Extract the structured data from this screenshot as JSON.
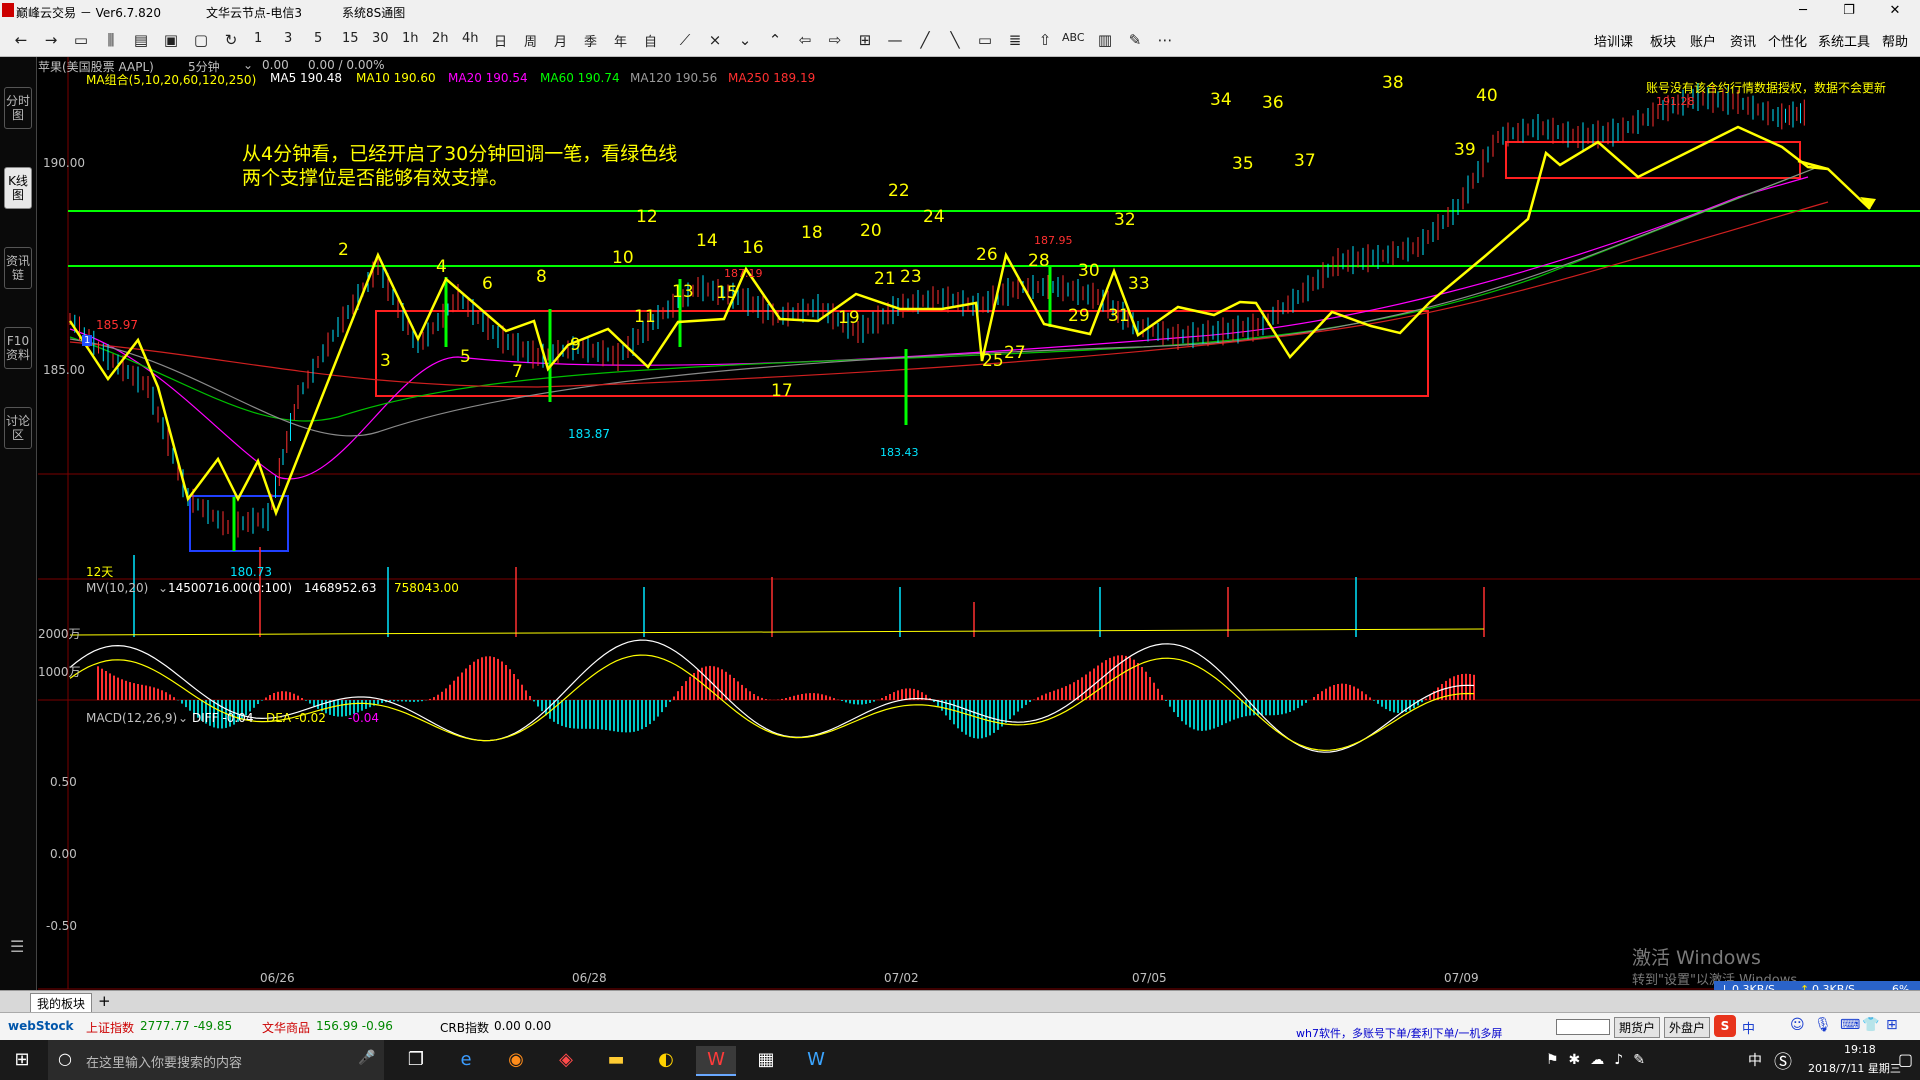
{
  "window": {
    "app_title": "巅峰云交易 － Ver6.7.820",
    "server": "文华云节点-电信3",
    "system_menu": "系统8S通图",
    "minimize": "─",
    "restore": "❐",
    "close": "✕"
  },
  "toolbar": {
    "periods": [
      "1",
      "3",
      "5",
      "15",
      "30",
      "1h",
      "2h",
      "4h",
      "日",
      "周",
      "月",
      "季",
      "年",
      "自"
    ],
    "label_abc": "ABC",
    "menus": [
      "培训课",
      "板块",
      "账户",
      "资讯",
      "个性化",
      "系统工具",
      "帮助"
    ]
  },
  "side_tabs": [
    "分时图",
    "K线图",
    "资讯链",
    "F10资料",
    "讨论区"
  ],
  "instrument": {
    "name": "苹果(美国股票 AAPL)",
    "period": "5分钟",
    "price": "0.00",
    "change": "0.00 / 0.00%"
  },
  "ma_legend": {
    "group": "MA组合(5,10,20,60,120,250)",
    "items": [
      {
        "label": "MA5 190.48",
        "color": "#ffffff"
      },
      {
        "label": "MA10 190.60",
        "color": "#ffff00"
      },
      {
        "label": "MA20 190.54",
        "color": "#ff00ff"
      },
      {
        "label": "MA60 190.74",
        "color": "#00ff00"
      },
      {
        "label": "MA120 190.56",
        "color": "#9a9a9a"
      },
      {
        "label": "MA250 189.19",
        "color": "#ff3030"
      }
    ]
  },
  "price_axis": {
    "top": "190.00",
    "mid": "185.00"
  },
  "annotation": {
    "line1": "从4分钟看，已经开启了30分钟回调一笔，看绿色线",
    "line2": "两个支撑位是否能够有效支撑。"
  },
  "notice": "账号没有该合约行情数据授权，数据不会更新",
  "price_labels": [
    "185.97",
    "187.19",
    "187.95",
    "183.87",
    "183.43",
    "180.73",
    "191.28",
    "1",
    "12天"
  ],
  "wave_numbers": [
    "2",
    "3",
    "4",
    "5",
    "6",
    "7",
    "8",
    "9",
    "10",
    "11",
    "12",
    "13",
    "14",
    "15",
    "16",
    "17",
    "18",
    "19",
    "20",
    "21",
    "22",
    "23",
    "24",
    "25",
    "26",
    "27",
    "28",
    "29",
    "30",
    "31",
    "32",
    "33",
    "34",
    "35",
    "36",
    "37",
    "38",
    "39",
    "40"
  ],
  "volume": {
    "header": "MV(10,20)",
    "value1": "14500716.00(0:100)",
    "value2": "1468952.63",
    "value3": "758043.00",
    "axis": [
      "2000万",
      "1000万"
    ]
  },
  "macd": {
    "header": "MACD(12,26,9)",
    "diff": "DIFF -0.04",
    "dea": "DEA -0.02",
    "macd": "-0.04",
    "axis": [
      "0.50",
      "0.00",
      "-0.50"
    ]
  },
  "dates": [
    "06/26",
    "06/28",
    "07/02",
    "07/05",
    "07/09"
  ],
  "watermark": {
    "line1": "激活 Windows",
    "line2": "转到\"设置\"以激活 Windows。"
  },
  "net_speed": {
    "down": "0.3KB/S",
    "up": "0.3KB/S",
    "pct": "6%"
  },
  "bottom_tabs": {
    "tab": "我的板块",
    "add": "+"
  },
  "status": {
    "logo": "webStock",
    "idx1_name": "上证指数",
    "idx1_val": "2777.77 -49.85",
    "idx2_name": "文华商品",
    "idx2_val": "156.99 -0.96",
    "idx3_name": "CRB指数",
    "idx3_val": "0.00 0.00",
    "ad_line1": "wh7软件，多账号下单/套利下单/一机多屏",
    "btn_futures": "期货户",
    "btn_forex": "外盘户",
    "ime": "中"
  },
  "taskbar": {
    "search_placeholder": "在这里输入你要搜索的内容",
    "ime": "中",
    "time": "19:18",
    "date": "2018/7/11 星期三"
  }
}
